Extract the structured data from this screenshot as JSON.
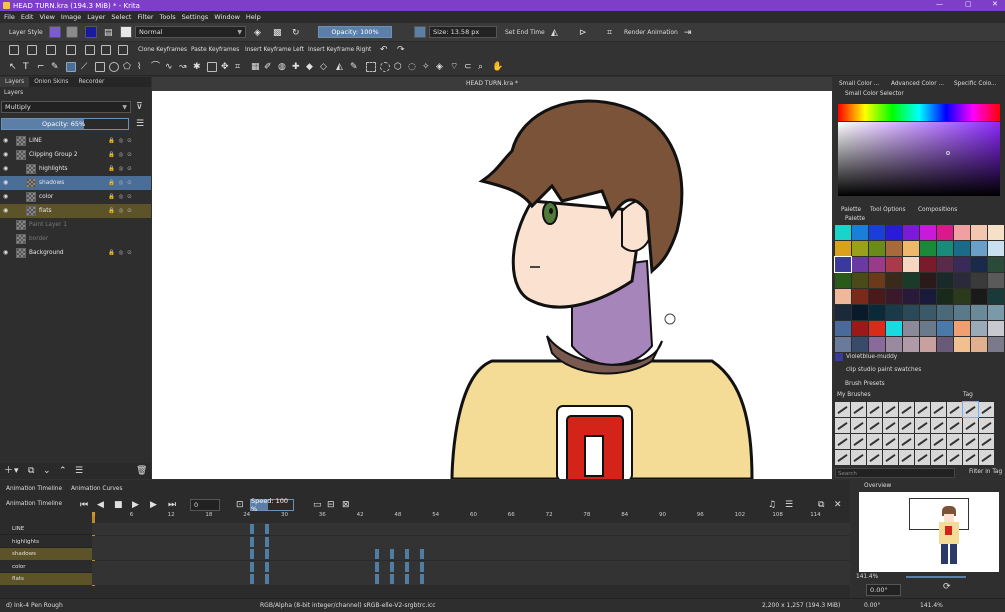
{
  "window": {
    "title": "HEAD TURN.kra (194.3 MiB)  * - Krita"
  },
  "menu": [
    "File",
    "Edit",
    "View",
    "Image",
    "Layer",
    "Select",
    "Filter",
    "Tools",
    "Settings",
    "Window",
    "Help"
  ],
  "options_bar": {
    "layer_style": "Layer Style",
    "blend_mode": "Normal",
    "opacity": "Opacity: 100%",
    "size": "Size: 13.58 px",
    "set_end_time": "Set End Time",
    "render_animation": "Render Animation"
  },
  "keyframe_bar": [
    "Clone Keyframes",
    "Paste Keyframes",
    "Insert Keyframe Left",
    "Insert Keyframe Right"
  ],
  "layers_docker": {
    "tabs": [
      "Layers",
      "Onion Skins",
      "Recorder"
    ],
    "panel_title": "Layers",
    "blend": "Multiply",
    "opacity": "Opacity:  65%",
    "layers": [
      {
        "name": "LINE",
        "indent": 0,
        "style": "normal"
      },
      {
        "name": "Clipping Group 2",
        "indent": 0,
        "style": "normal"
      },
      {
        "name": "highlights",
        "indent": 1,
        "style": "normal"
      },
      {
        "name": "shadows",
        "indent": 1,
        "style": "selected"
      },
      {
        "name": "color",
        "indent": 1,
        "style": "normal"
      },
      {
        "name": "flats",
        "indent": 1,
        "style": "gold"
      },
      {
        "name": "Paint Layer 1",
        "indent": 0,
        "style": "dim"
      },
      {
        "name": "border",
        "indent": 0,
        "style": "dim"
      },
      {
        "name": "Background",
        "indent": 0,
        "style": "normal"
      }
    ]
  },
  "document_tab": "HEAD TURN.kra *",
  "right_docker": {
    "top_tabs": [
      "Small Color ...",
      "Advanced Color ...",
      "Specific Colo..."
    ],
    "color_selector_title": "Small Color Selector",
    "mid_tabs": [
      "Palette",
      "Tool Options",
      "Compositions"
    ],
    "palette_title": "Palette",
    "palette_colors": [
      "#1ad3c9",
      "#1a7fd9",
      "#1a3fd9",
      "#2a1ad9",
      "#7d1ad9",
      "#c81ad9",
      "#d91a8c",
      "#f0a0a0",
      "#f3c6b0",
      "#f6e0c8",
      "#d9a21a",
      "#9aa01a",
      "#6a8a1a",
      "#a86a3a",
      "#f0b86a",
      "#1a8a3a",
      "#1a8a7a",
      "#1a6a8a",
      "#6aa0c8",
      "#c8e0f0",
      "#3a3a9a",
      "#6a3aa0",
      "#9a3a8a",
      "#a83a4a",
      "#f6d6c0",
      "#7a1a2a",
      "#5a2a4a",
      "#3a2a5a",
      "#1a2a4a",
      "#2a4a3a",
      "#2a5a1a",
      "#4a4a1a",
      "#6a3a1a",
      "#3a2a1a",
      "#1a3a2a",
      "#2a1a1a",
      "#1a2a2a",
      "#2a2a3a",
      "#3a3a3a",
      "#5a5a5a",
      "#f0b89a",
      "#7a2a1a",
      "#4a1a1a",
      "#3a1a2a",
      "#2a1a3a",
      "#1a1a3a",
      "#1a2a1a",
      "#2a3a1a",
      "#1a1a1a",
      "#1a3a3a",
      "#1a2a3a",
      "#0a1a2a",
      "#0a2a3a",
      "#1a3a4a",
      "#2a4a5a",
      "#3a5a6a",
      "#4a6a7a",
      "#5a7a8a",
      "#6a8a9a",
      "#7a9aaa",
      "#4a6a9a",
      "#9a1a1a",
      "#d92a1a",
      "#1ad9e0",
      "#8a8a9a",
      "#6a7a8a",
      "#4a7aaa",
      "#f0a070",
      "#9aaab8",
      "#c8c8d0",
      "#6a7a9a",
      "#3a4a6a",
      "#8a6a9a",
      "#9a8aa0",
      "#b09aa8",
      "#c8a0a0",
      "#6a5a7a",
      "#f0c090",
      "#e0b090",
      "#7a7a8a"
    ],
    "swatch_name": "Violetblue-muddy",
    "swatch_set": "clip studio paint swatches",
    "brush_title": "Brush Presets",
    "brush_set": "My Brushes",
    "brush_tag": "Tag",
    "search_placeholder": "Search",
    "filter": "Filter in Tag"
  },
  "timeline": {
    "tabs": [
      "Animation Timeline",
      "Animation Curves"
    ],
    "title": "Animation Timeline",
    "frame": "0",
    "speed": "Speed: 100 %",
    "ticks": [
      "0",
      "6",
      "12",
      "18",
      "24",
      "30",
      "36",
      "42",
      "48",
      "54",
      "60",
      "66",
      "72",
      "78",
      "84",
      "90",
      "96",
      "102",
      "108",
      "114"
    ],
    "rows": [
      "LINE",
      "highlights",
      "shadows",
      "color",
      "flats"
    ]
  },
  "overview": {
    "title": "Overview",
    "zoom": "141.4%",
    "rotation": "0.00°"
  },
  "status": {
    "brush": "d) Ink-4 Pen Rough",
    "color_space": "RGB/Alpha (8-bit integer/channel)  sRGB-elle-V2-srgbtrc.icc",
    "size": "2,200 x 1,257 (194.3 MiB)",
    "rotation": "0.00°",
    "zoom": "141.4%"
  }
}
